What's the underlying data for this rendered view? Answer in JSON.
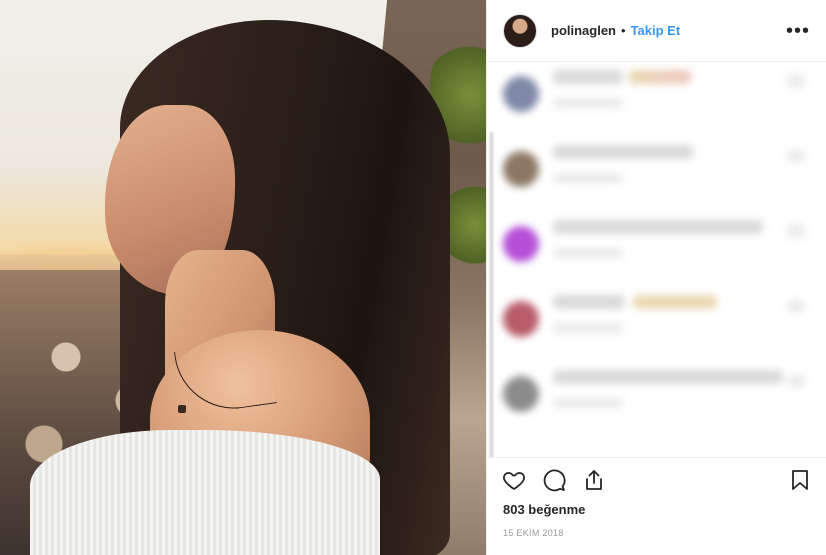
{
  "post": {
    "photo_alt": "",
    "header": {
      "username": "polinaglen",
      "separator": "•",
      "follow_label": "Takip Et",
      "more_label": "•••"
    },
    "comments": [
      {
        "avatar_color": "#7f88a8",
        "name_width": "w1",
        "extra": true
      },
      {
        "avatar_color": "#8d7764",
        "name_width": "w2",
        "extra": false
      },
      {
        "avatar_color": "#b54fd8",
        "name_width": "w3",
        "extra": false
      },
      {
        "avatar_color": "#b85c6a",
        "name_width": "w4",
        "extra": true
      },
      {
        "avatar_color": "#8c8c8c",
        "name_width": "w5",
        "extra": false
      }
    ],
    "actions": {
      "like_icon": "heart-icon",
      "comment_icon": "comment-icon",
      "share_icon": "share-icon",
      "save_icon": "bookmark-icon"
    },
    "likes_label": "803 beğenme",
    "date_label": "15 EKİM 2018",
    "colors": {
      "accent": "#3897f0",
      "text": "#262626",
      "muted": "#999999",
      "border": "#efefef"
    }
  }
}
